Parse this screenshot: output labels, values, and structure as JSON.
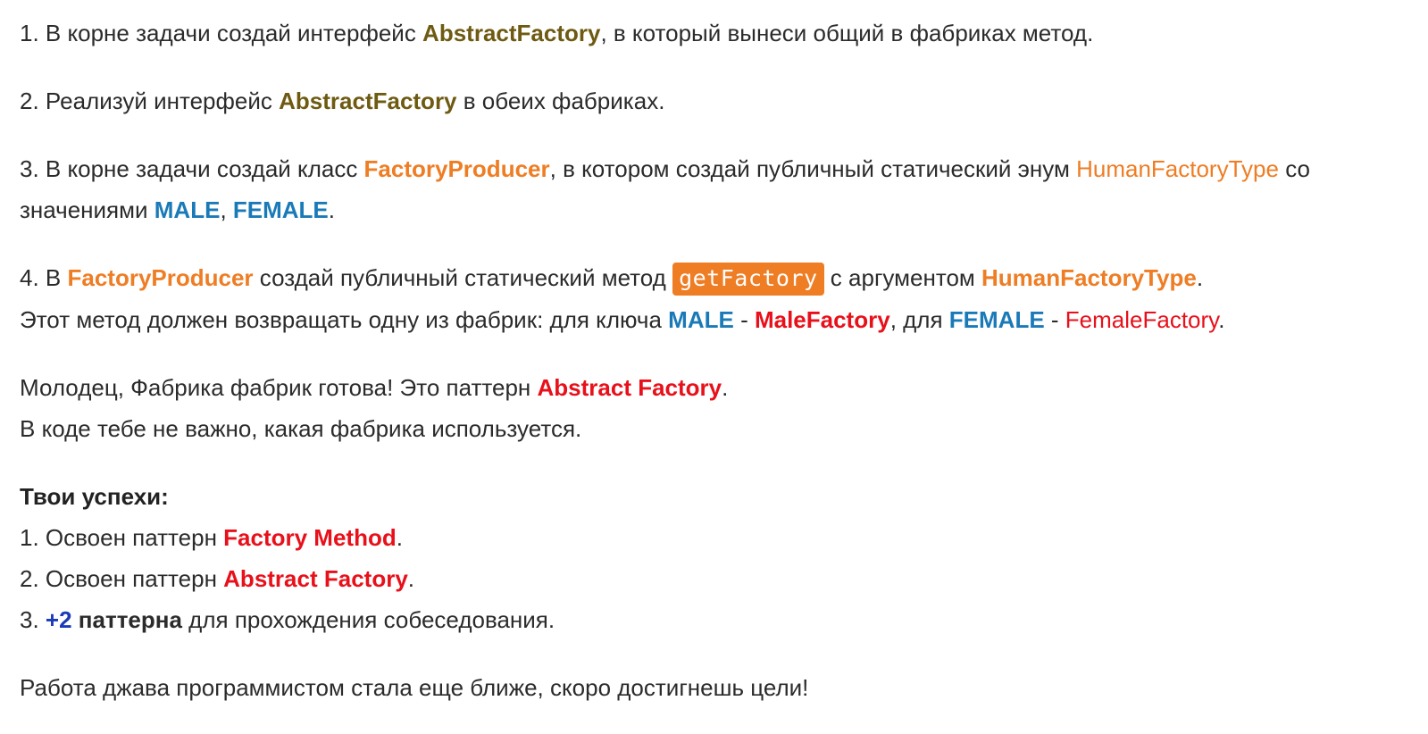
{
  "step1": {
    "before": "1. В корне задачи создай интерфейс ",
    "interface_name": "AbstractFactory",
    "after": ", в который вынеси общий в фабриках метод."
  },
  "step2": {
    "before": "2. Реализуй интерфейс ",
    "interface_name": "AbstractFactory",
    "after": " в обеих фабриках."
  },
  "step3": {
    "before": "3. В корне задачи создай класс ",
    "class_name": "FactoryProducer",
    "middle": ", в котором создай публичный статический энум ",
    "enum_name": "HumanFactoryType",
    "after": " со",
    "line2_before": "значениями ",
    "male": "MALE",
    "comma": ", ",
    "female": "FEMALE",
    "dot": "."
  },
  "step4": {
    "num": "4. В ",
    "class_name": "FactoryProducer",
    "middle": " создай публичный статический метод ",
    "method_name": "getFactory",
    "arg_text": " с аргументом ",
    "arg_type": "HumanFactoryType",
    "dot": ".",
    "line2_before": "Этот метод должен возвращать одну из фабрик: для ключа ",
    "male": "MALE",
    "dash1": " - ",
    "male_factory": "MaleFactory",
    "for_text": ", для ",
    "female": "FEMALE",
    "dash2": " - ",
    "female_factory": "FemaleFactory",
    "dot2": "."
  },
  "congrats": {
    "before": "Молодец, Фабрика фабрик готова! Это паттерн ",
    "pattern": "Abstract Factory",
    "dot": ".",
    "line2": "В коде тебе не важно, какая фабрика используется."
  },
  "achievements": {
    "title": "Твои успехи:",
    "item1_before": "1. Освоен паттерн ",
    "item1_pattern": "Factory Method",
    "item1_dot": ".",
    "item2_before": "2. Освоен паттерн ",
    "item2_pattern": "Abstract Factory",
    "item2_dot": ".",
    "item3_num": "3. ",
    "item3_plus": "+2",
    "item3_bold": " паттерна",
    "item3_after": " для прохождения собеседования."
  },
  "closing": "Работа джава программистом стала еще ближе, скоро достигнешь цели!"
}
